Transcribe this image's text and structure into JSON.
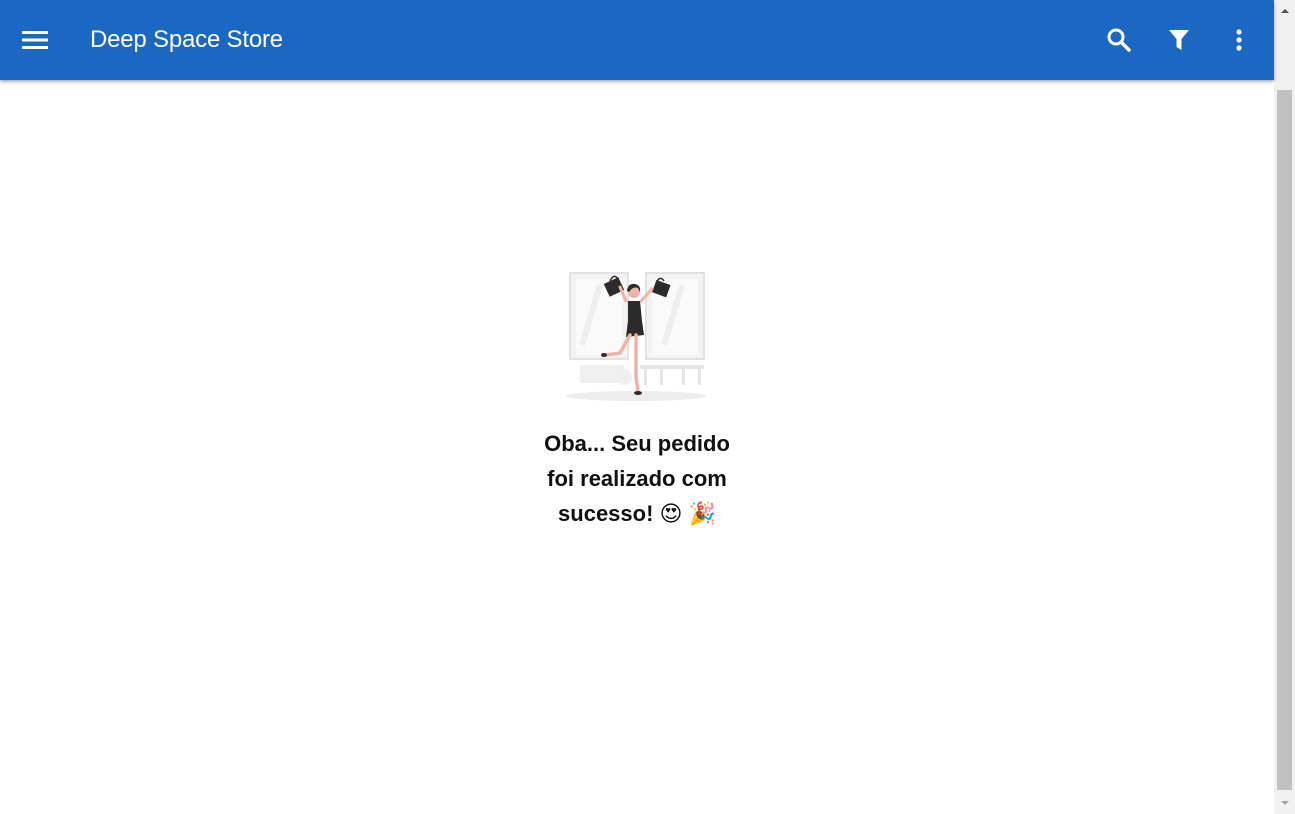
{
  "header": {
    "title": "Deep Space Store",
    "background_color": "#1b68c2",
    "text_color": "#ffffff",
    "menu_icon": "menu-icon",
    "actions": [
      {
        "name": "search",
        "icon": "search-icon"
      },
      {
        "name": "filter",
        "icon": "filter-icon"
      },
      {
        "name": "more",
        "icon": "more-vert-icon"
      }
    ]
  },
  "main": {
    "illustration": "woman-celebrating-shopping-bags",
    "message": "Oba... Seu pedido foi realizado com sucesso! 😍 🎉"
  },
  "scrollbar": {
    "up_icon": "scroll-up-arrow-icon",
    "down_icon": "scroll-down-arrow-icon"
  }
}
